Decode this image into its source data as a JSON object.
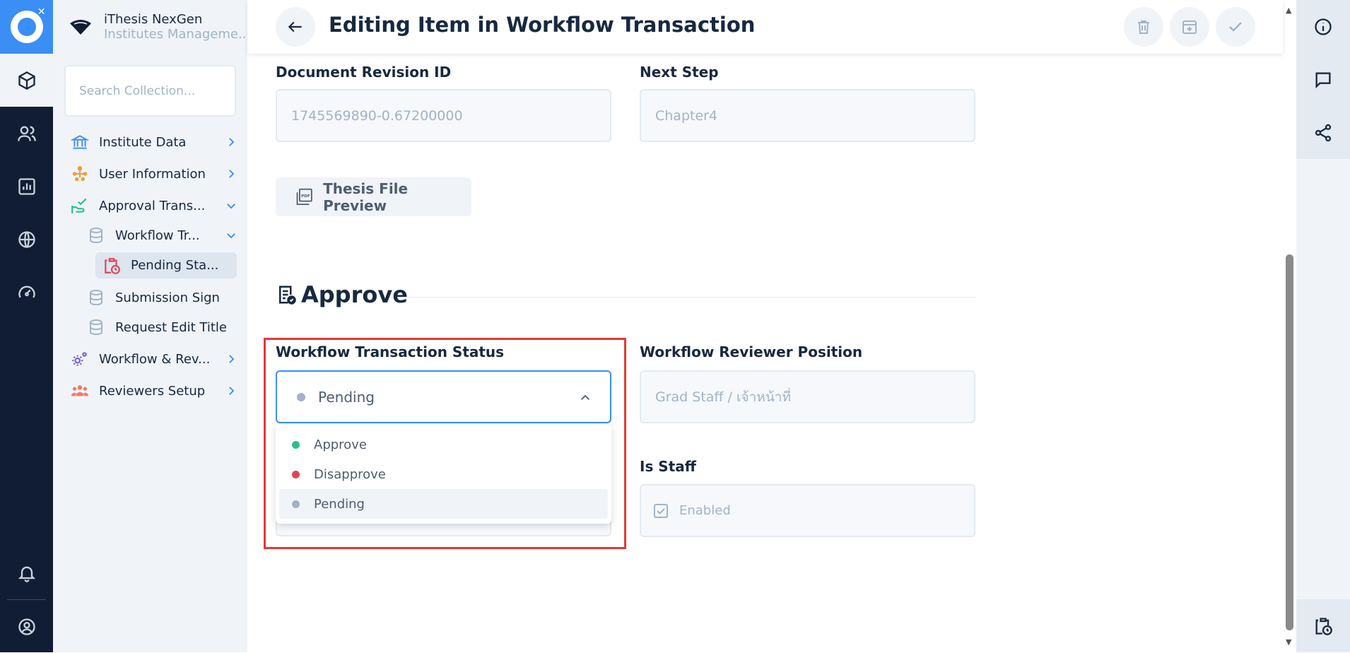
{
  "app": {
    "name": "iThesis NexGen",
    "subtitle": "Institutes Manageme..."
  },
  "search": {
    "placeholder": "Search Collection..."
  },
  "sidebar": {
    "items": [
      {
        "label": "Institute Data",
        "icon": "bank-icon"
      },
      {
        "label": "User Information",
        "icon": "org-chart-icon"
      },
      {
        "label": "Approval Trans...",
        "icon": "hand-check-icon"
      },
      {
        "label": "Workflow Tr...",
        "icon": "database-icon"
      },
      {
        "label": "Pending Sta...",
        "icon": "clipboard-clock-icon"
      },
      {
        "label": "Submission Sign",
        "icon": "database-icon"
      },
      {
        "label": "Request Edit Title",
        "icon": "database-icon"
      },
      {
        "label": "Workflow & Rev...",
        "icon": "gears-icon"
      },
      {
        "label": "Reviewers Setup",
        "icon": "people-group-icon"
      }
    ]
  },
  "header": {
    "title": "Editing Item in Workflow Transaction"
  },
  "form": {
    "document_revision_id": {
      "label": "Document Revision ID",
      "value": "1745569890-0.67200000"
    },
    "next_step": {
      "label": "Next Step",
      "value": "Chapter4"
    },
    "pdf_button": "Thesis File Preview",
    "section_title": "Approve",
    "status": {
      "label": "Workflow Transaction Status",
      "selected": "Pending",
      "options": [
        {
          "label": "Approve",
          "color": "#2cc08e"
        },
        {
          "label": "Disapprove",
          "color": "#e0445a"
        },
        {
          "label": "Pending",
          "color": "#a2b3c7"
        }
      ]
    },
    "reviewer_position": {
      "label": "Workflow Reviewer Position",
      "value": "Grad Staff / เจ้าหน้าที่"
    },
    "is_staff": {
      "label": "Is Staff",
      "value": "Enabled"
    }
  },
  "colors": {
    "accent": "#3a8ef6",
    "rail": "#101d34",
    "highlight": "#e53935"
  }
}
